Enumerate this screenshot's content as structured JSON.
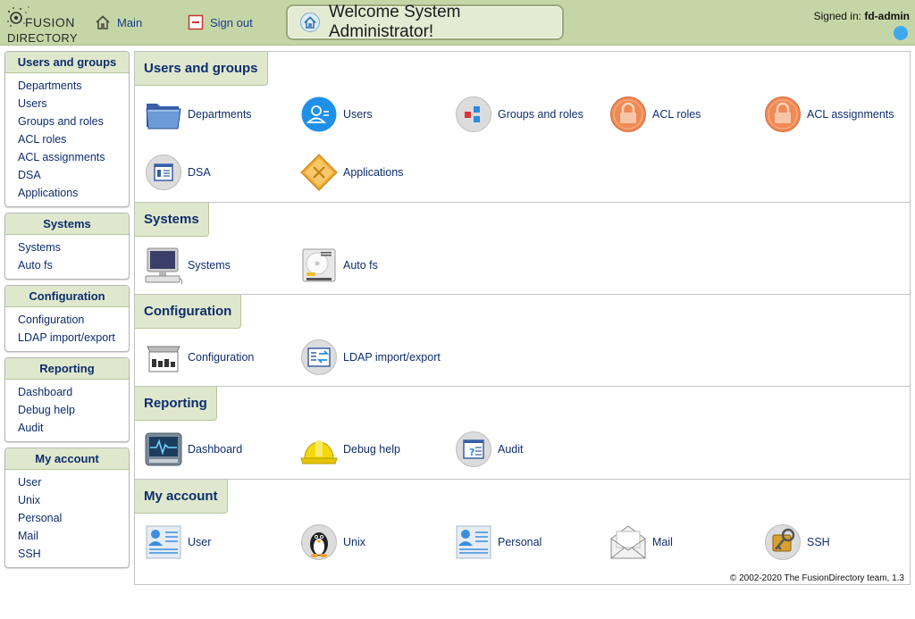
{
  "header": {
    "logo_line1": "FUSION",
    "logo_line2": "DIRECTORY",
    "main_label": "Main",
    "signout_label": "Sign out",
    "welcome_text": "Welcome System Administrator!",
    "signed_in_prefix": "Signed in: ",
    "signed_in_user": "fd-admin",
    "accent_color": "#3fa9f0"
  },
  "sidebar": {
    "groups": [
      {
        "title": "Users and groups",
        "items": [
          "Departments",
          "Users",
          "Groups and roles",
          "ACL roles",
          "ACL assignments",
          "DSA",
          "Applications"
        ]
      },
      {
        "title": "Systems",
        "items": [
          "Systems",
          "Auto fs"
        ]
      },
      {
        "title": "Configuration",
        "items": [
          "Configuration",
          "LDAP import/export"
        ]
      },
      {
        "title": "Reporting",
        "items": [
          "Dashboard",
          "Debug help",
          "Audit"
        ]
      },
      {
        "title": "My account",
        "items": [
          "User",
          "Unix",
          "Personal",
          "Mail",
          "SSH"
        ]
      }
    ]
  },
  "main": {
    "sections": [
      {
        "title": "Users and groups",
        "items": [
          {
            "label": "Departments",
            "icon": "folder-icon"
          },
          {
            "label": "Users",
            "icon": "user-circle-icon"
          },
          {
            "label": "Groups and roles",
            "icon": "groups-icon"
          },
          {
            "label": "ACL roles",
            "icon": "lock-icon"
          },
          {
            "label": "ACL assignments",
            "icon": "lock-icon"
          },
          {
            "label": "DSA",
            "icon": "dsa-icon"
          },
          {
            "label": "Applications",
            "icon": "applications-icon"
          }
        ]
      },
      {
        "title": "Systems",
        "items": [
          {
            "label": "Systems",
            "icon": "computer-icon"
          },
          {
            "label": "Auto fs",
            "icon": "disk-icon"
          }
        ]
      },
      {
        "title": "Configuration",
        "items": [
          {
            "label": "Configuration",
            "icon": "configuration-icon"
          },
          {
            "label": "LDAP import/export",
            "icon": "ldap-import-export-icon"
          }
        ]
      },
      {
        "title": "Reporting",
        "items": [
          {
            "label": "Dashboard",
            "icon": "dashboard-monitor-icon"
          },
          {
            "label": "Debug help",
            "icon": "hard-hat-icon"
          },
          {
            "label": "Audit",
            "icon": "audit-icon"
          }
        ]
      },
      {
        "title": "My account",
        "items": [
          {
            "label": "User",
            "icon": "user-card-icon"
          },
          {
            "label": "Unix",
            "icon": "penguin-icon"
          },
          {
            "label": "Personal",
            "icon": "user-card-icon"
          },
          {
            "label": "Mail",
            "icon": "envelope-icon"
          },
          {
            "label": "SSH",
            "icon": "ssh-key-icon"
          }
        ]
      }
    ]
  },
  "footer": {
    "text": "© 2002-2020 The FusionDirectory team, 1.3"
  }
}
